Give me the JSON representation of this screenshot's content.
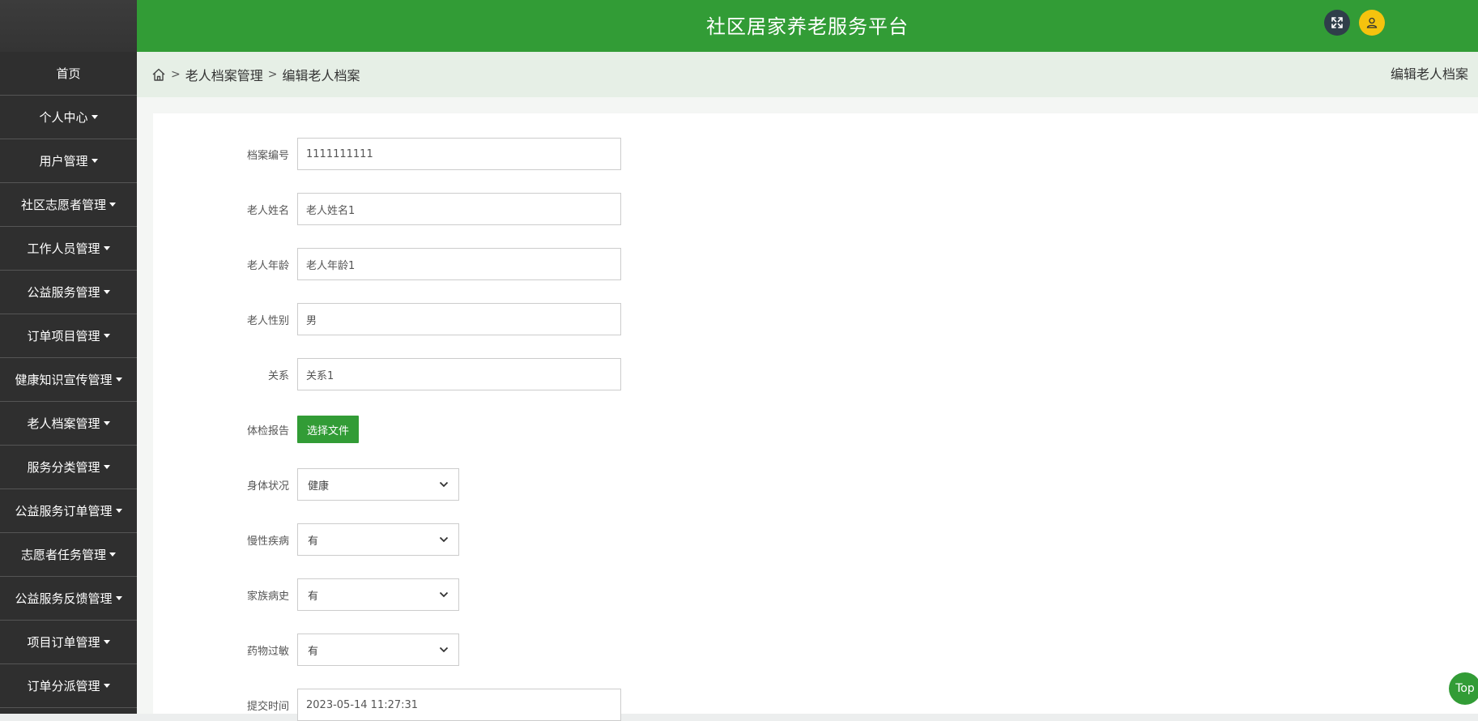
{
  "app": {
    "title": "社区居家养老服务平台"
  },
  "sidebar": {
    "items": [
      {
        "label": "首页",
        "caret": false
      },
      {
        "label": "个人中心",
        "caret": true
      },
      {
        "label": "用户管理",
        "caret": true
      },
      {
        "label": "社区志愿者管理",
        "caret": true
      },
      {
        "label": "工作人员管理",
        "caret": true
      },
      {
        "label": "公益服务管理",
        "caret": true
      },
      {
        "label": "订单项目管理",
        "caret": true
      },
      {
        "label": "健康知识宣传管理",
        "caret": true
      },
      {
        "label": "老人档案管理",
        "caret": true
      },
      {
        "label": "服务分类管理",
        "caret": true
      },
      {
        "label": "公益服务订单管理",
        "caret": true
      },
      {
        "label": "志愿者任务管理",
        "caret": true
      },
      {
        "label": "公益服务反馈管理",
        "caret": true
      },
      {
        "label": "项目订单管理",
        "caret": true
      },
      {
        "label": "订单分派管理",
        "caret": true
      }
    ]
  },
  "breadcrumb": {
    "sep": ">",
    "level1": "老人档案管理",
    "level2": "编辑老人档案",
    "page_title": "编辑老人档案"
  },
  "form": {
    "archive_no": {
      "label": "档案编号",
      "value": "1111111111"
    },
    "elder_name": {
      "label": "老人姓名",
      "value": "老人姓名1"
    },
    "elder_age": {
      "label": "老人年龄",
      "value": "老人年龄1"
    },
    "elder_gender": {
      "label": "老人性别",
      "value": "男"
    },
    "relation": {
      "label": "关系",
      "value": "关系1"
    },
    "report": {
      "label": "体检报告",
      "button": "选择文件"
    },
    "health": {
      "label": "身体状况",
      "value": "健康"
    },
    "chronic": {
      "label": "慢性疾病",
      "value": "有"
    },
    "family_history": {
      "label": "家族病史",
      "value": "有"
    },
    "drug_allergy": {
      "label": "药物过敏",
      "value": "有"
    },
    "submit_time": {
      "label": "提交时间",
      "value": "2023-05-14 11:27:31"
    }
  },
  "top_button": {
    "label": "Top"
  },
  "colors": {
    "brand": "#329c36",
    "sidebar_bg": "#2f2f2f",
    "user_icon_bg": "#f5c30e",
    "fullscreen_icon_bg": "#2f3e4a"
  },
  "icons": {
    "fullscreen": "expand-arrows-icon",
    "user": "user-icon",
    "home": "home-icon",
    "select": "chevron-down-icon"
  }
}
